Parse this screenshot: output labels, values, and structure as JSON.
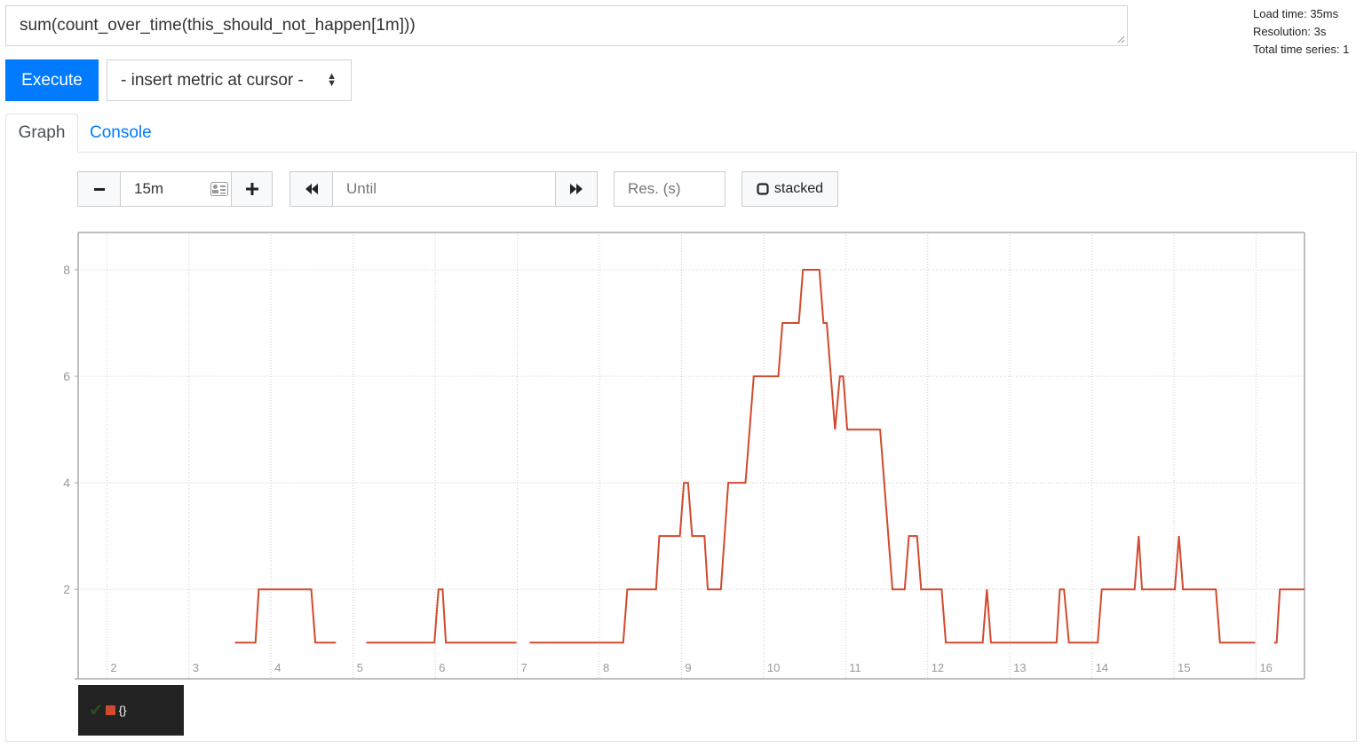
{
  "query": {
    "expression": "sum(count_over_time(this_should_not_happen[1m]))"
  },
  "stats": {
    "load_time": "Load time: 35ms",
    "resolution": "Resolution: 3s",
    "total_series": "Total time series: 1"
  },
  "toolbar": {
    "execute_label": "Execute",
    "metric_select_label": "- insert metric at cursor -"
  },
  "tabs": [
    {
      "label": "Graph",
      "active": true
    },
    {
      "label": "Console",
      "active": false
    }
  ],
  "graph_controls": {
    "range_minus": "−",
    "range_value": "15m",
    "range_plus": "+",
    "until_placeholder": "Until",
    "res_placeholder": "Res. (s)",
    "stacked_label": "stacked",
    "stacked_checked": false
  },
  "legend": {
    "series_label": "{}",
    "color": "#d24a2d",
    "checked": true
  },
  "chart_data": {
    "type": "line",
    "title": "",
    "xlabel": "",
    "ylabel": "",
    "xlim": [
      1.65,
      16.59
    ],
    "ylim": [
      0.32,
      8.7
    ],
    "x_ticks": [
      2,
      3,
      4,
      5,
      6,
      7,
      8,
      9,
      10,
      11,
      12,
      13,
      14,
      15,
      16
    ],
    "y_ticks": [
      2,
      4,
      6,
      8
    ],
    "grid": true,
    "legend_position": "bottom-left",
    "series": [
      {
        "name": "{}",
        "color": "#d24a2d",
        "segments": [
          [
            [
              3.56,
              1
            ],
            [
              3.81,
              1
            ],
            [
              3.85,
              2
            ],
            [
              4.49,
              2
            ],
            [
              4.54,
              1
            ],
            [
              4.79,
              1
            ]
          ],
          [
            [
              5.16,
              1
            ],
            [
              5.99,
              1
            ],
            [
              6.04,
              2
            ],
            [
              6.09,
              2
            ],
            [
              6.13,
              1
            ],
            [
              6.99,
              1
            ]
          ],
          [
            [
              7.15,
              1
            ],
            [
              8.29,
              1
            ],
            [
              8.34,
              2
            ],
            [
              8.69,
              2
            ],
            [
              8.73,
              3
            ],
            [
              8.98,
              3
            ],
            [
              9.03,
              4
            ],
            [
              9.08,
              4
            ],
            [
              9.13,
              3
            ],
            [
              9.28,
              3
            ],
            [
              9.32,
              2
            ],
            [
              9.48,
              2
            ],
            [
              9.57,
              4
            ],
            [
              9.78,
              4
            ],
            [
              9.88,
              6
            ],
            [
              10.18,
              6
            ],
            [
              10.23,
              7
            ],
            [
              10.43,
              7
            ],
            [
              10.48,
              8
            ],
            [
              10.68,
              8
            ],
            [
              10.73,
              7
            ],
            [
              10.77,
              7
            ],
            [
              10.87,
              5
            ],
            [
              10.93,
              6
            ],
            [
              10.97,
              6
            ],
            [
              11.02,
              5
            ],
            [
              11.42,
              5
            ],
            [
              11.57,
              2
            ],
            [
              11.72,
              2
            ],
            [
              11.77,
              3
            ],
            [
              11.87,
              3
            ],
            [
              11.92,
              2
            ],
            [
              12.17,
              2
            ],
            [
              12.22,
              1
            ],
            [
              12.67,
              1
            ],
            [
              12.72,
              2
            ],
            [
              12.77,
              1
            ],
            [
              13.57,
              1
            ],
            [
              13.61,
              2
            ],
            [
              13.66,
              2
            ],
            [
              13.72,
              1
            ],
            [
              14.07,
              1
            ],
            [
              14.12,
              2
            ],
            [
              14.52,
              2
            ],
            [
              14.57,
              3
            ],
            [
              14.61,
              2
            ],
            [
              15.01,
              2
            ],
            [
              15.06,
              3
            ],
            [
              15.11,
              2
            ],
            [
              15.51,
              2
            ],
            [
              15.56,
              1
            ],
            [
              15.99,
              1
            ]
          ],
          [
            [
              16.22,
              1
            ],
            [
              16.25,
              1
            ],
            [
              16.29,
              2
            ],
            [
              16.59,
              2
            ]
          ]
        ]
      }
    ]
  }
}
